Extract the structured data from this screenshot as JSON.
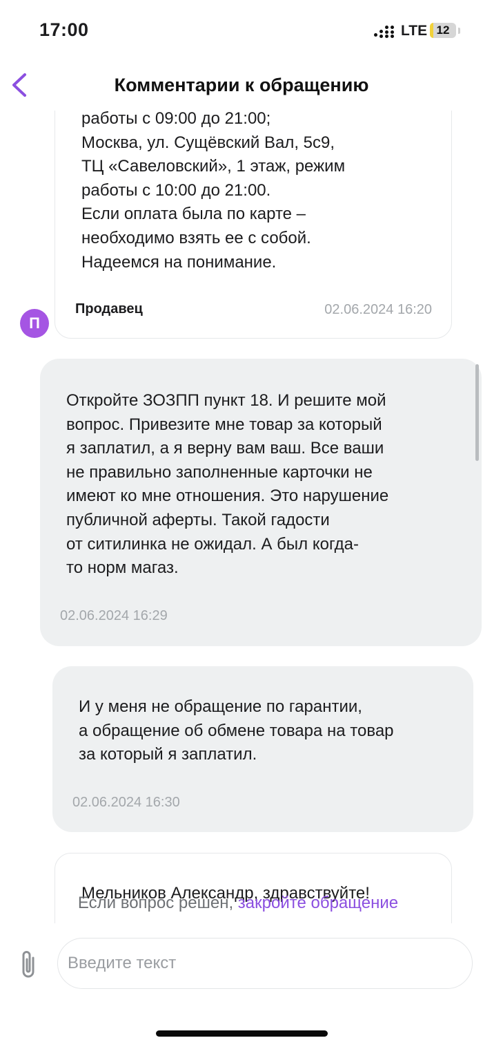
{
  "status_bar": {
    "time": "17:00",
    "network": "LTE",
    "battery": "12",
    "battery_fraction": 0.12
  },
  "header": {
    "title": "Комментарии к обращению",
    "back_icon": "chevron-left-icon",
    "accent_color": "#8b4fe0"
  },
  "seller_message": {
    "lines": [
      "работы с 09:00 до 21:00;",
      "Москва, ул. Сущёвский Вал, 5с9,",
      "ТЦ «Савеловский», 1 этаж, режим",
      "работы с 10:00 до 21:00.",
      "Если оплата была по карте –",
      "необходимо взять ее с собой.",
      "Надеемся на понимание."
    ],
    "sender": "Продавец",
    "timestamp": "02.06.2024 16:20",
    "avatar_letter": "П",
    "avatar_color": "#a555e3"
  },
  "user_message_1": {
    "lines": [
      "Откройте ЗОЗПП пункт 18. И решите мой",
      "вопрос. Привезите мне товар за который",
      "я заплатил, а я верну вам ваш. Все ваши",
      "не правильно заполненные карточки не",
      "имеют ко мне отношения. Это нарушение",
      "публичной аферты. Такой гадости",
      "от ситилинка не ожидал. А был когда-",
      "то норм магаз."
    ],
    "timestamp": "02.06.2024 16:29"
  },
  "user_message_2": {
    "lines": [
      "И у меня не обращение по гарантии,",
      "а обращение об обмене товара на товар",
      "за который я заплатил."
    ],
    "timestamp": "02.06.2024 16:30"
  },
  "partial_message": {
    "text": "Мельников Александр, здравствуйте!"
  },
  "resolved_note": {
    "prefix": "Если вопрос решен,",
    "link": "закройте обращение"
  },
  "composer": {
    "placeholder": "Введите текст",
    "attach_icon": "paperclip-icon"
  }
}
